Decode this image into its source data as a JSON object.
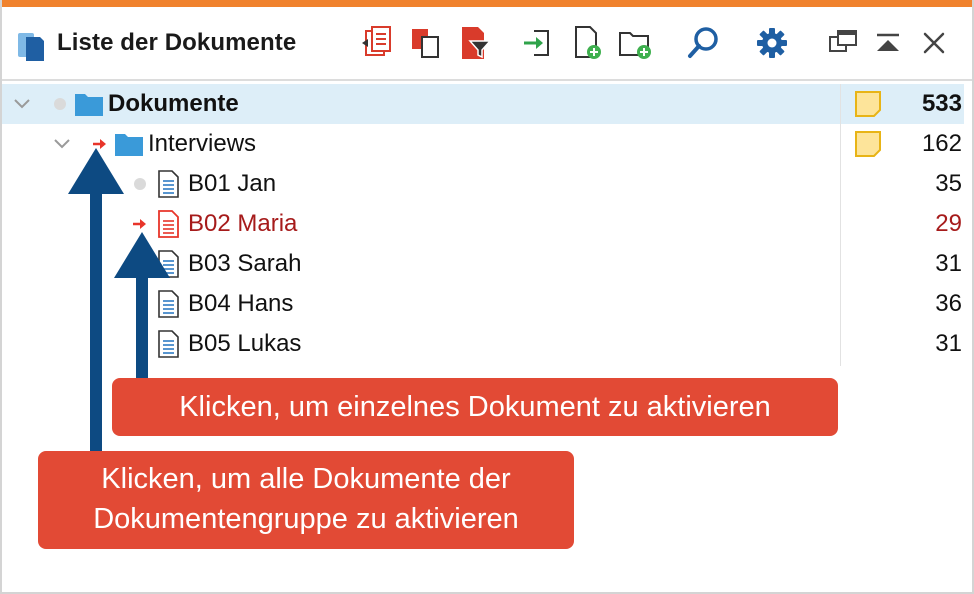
{
  "window": {
    "title": "Liste der Dokumente",
    "accent_color": "#f0822d"
  },
  "toolbar": {
    "icons": [
      "copy-documents-icon",
      "duplicate-icon",
      "filter-icon",
      "import-icon",
      "new-document-icon",
      "new-document-group-icon",
      "search-icon",
      "settings-icon",
      "undock-window-icon",
      "collapse-window-icon",
      "close-icon"
    ]
  },
  "tree": {
    "root": {
      "label": "Dokumente",
      "count": "533"
    },
    "group": {
      "label": "Interviews",
      "count": "162"
    },
    "documents": [
      {
        "label": "B01 Jan",
        "count": "35",
        "activated": false
      },
      {
        "label": "B02 Maria",
        "count": "29",
        "activated": true
      },
      {
        "label": "B03 Sarah",
        "count": "31",
        "activated": false
      },
      {
        "label": "B04 Hans",
        "count": "36",
        "activated": false
      },
      {
        "label": "B05 Lukas",
        "count": "31",
        "activated": false
      }
    ]
  },
  "annotations": {
    "single": "Klicken, um einzelnes Dokument zu aktivieren",
    "group_line1": "Klicken, um alle Dokumente der",
    "group_line2": "Dokumentengruppe zu aktivieren"
  },
  "colors": {
    "callout": "#e24a35",
    "arrow": "#0d4a82",
    "activated_text": "#a61b1b",
    "selected_row": "#ddeef8",
    "folder": "#3a9ad9"
  }
}
